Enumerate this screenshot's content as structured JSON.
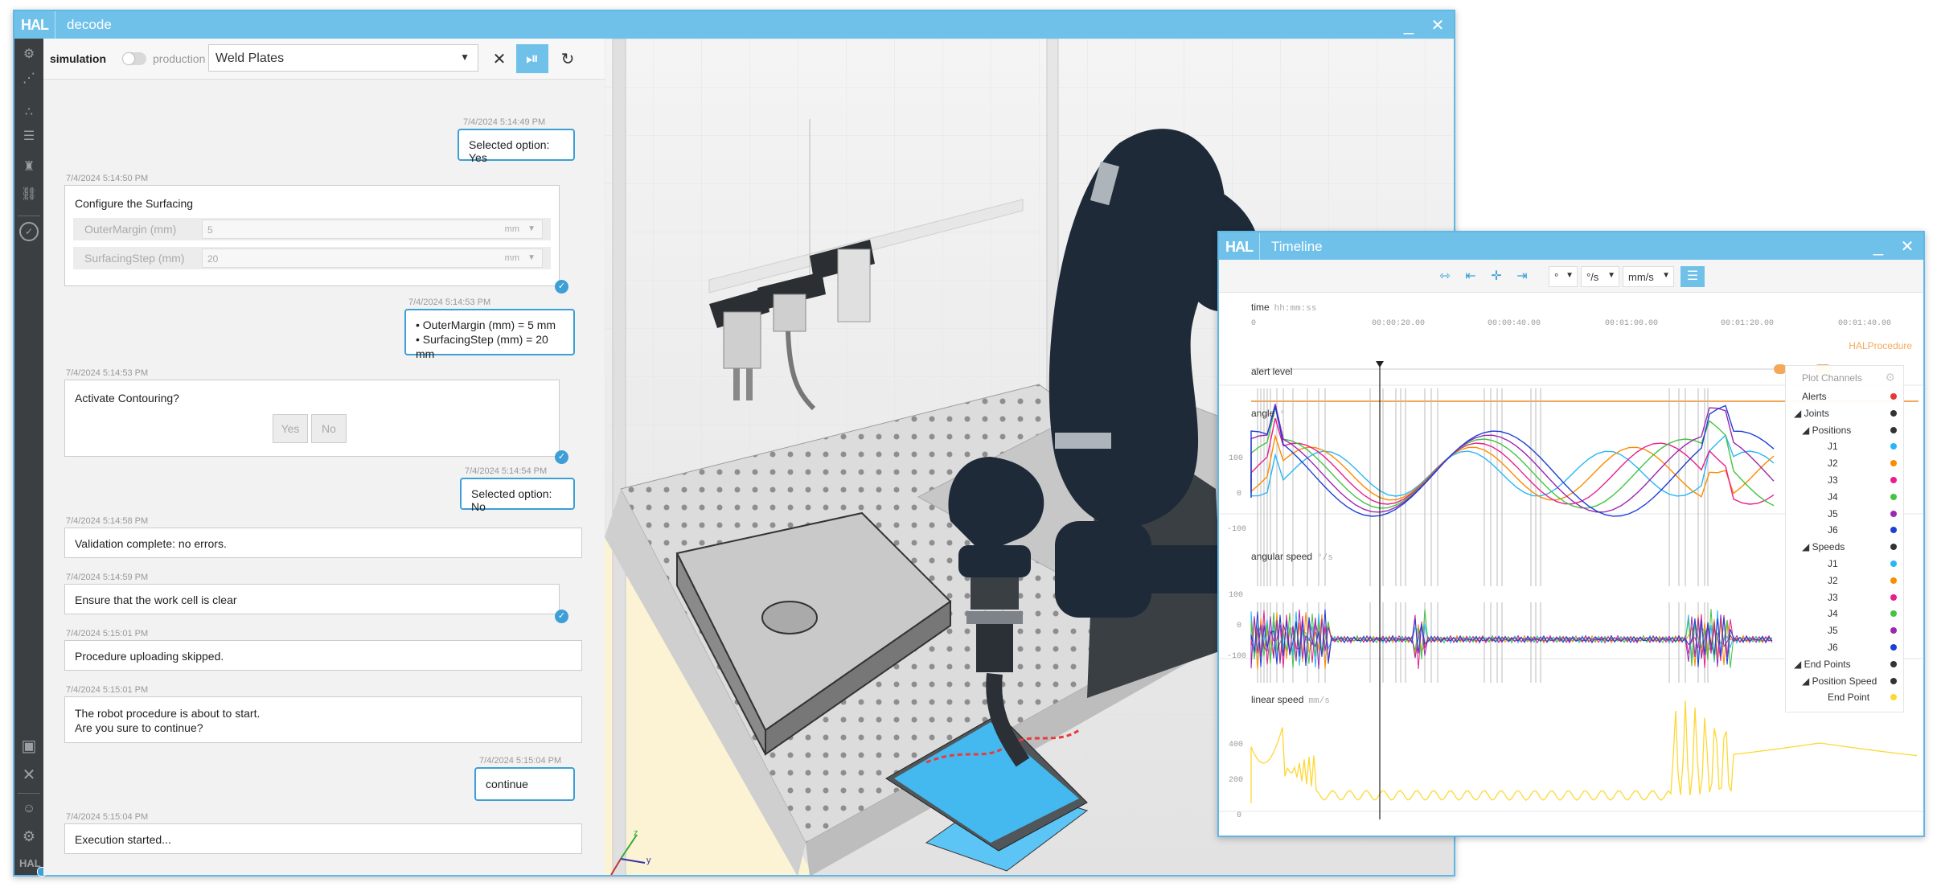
{
  "main_window": {
    "logo": "HAL",
    "title": "decode",
    "minimize": "_",
    "close": "✕"
  },
  "toolbar": {
    "mode_left": "simulation",
    "mode_right": "production",
    "procedure": "Weld Plates"
  },
  "chat": [
    {
      "stamp": "7/4/2024 5:14:49 PM",
      "text": "Selected option: Yes"
    },
    {
      "stamp": "7/4/2024 5:14:50 PM",
      "title": "Configure the Surfacing",
      "fields": [
        {
          "label": "OuterMargin (mm)",
          "value": "5",
          "unit": "mm"
        },
        {
          "label": "SurfacingStep (mm)",
          "value": "20",
          "unit": "mm"
        }
      ]
    },
    {
      "stamp": "7/4/2024 5:14:53 PM",
      "line1": "• OuterMargin (mm) = 5 mm",
      "line2": "• SurfacingStep (mm) = 20 mm"
    },
    {
      "stamp": "7/4/2024 5:14:53 PM",
      "title": "Activate Contouring?",
      "yes": "Yes",
      "no": "No"
    },
    {
      "stamp": "7/4/2024 5:14:54 PM",
      "text": "Selected option: No"
    },
    {
      "stamp": "7/4/2024 5:14:58 PM",
      "text": "Validation complete: no errors."
    },
    {
      "stamp": "7/4/2024 5:14:59 PM",
      "text": "Ensure that the work cell is clear"
    },
    {
      "stamp": "7/4/2024 5:15:01 PM",
      "text": "Procedure uploading skipped."
    },
    {
      "stamp": "7/4/2024 5:15:01 PM",
      "line1": "The robot procedure is about to start.",
      "line2": "Are you sure to continue?"
    },
    {
      "stamp": "7/4/2024 5:15:04 PM",
      "text": "continue"
    },
    {
      "stamp": "7/4/2024 5:15:04 PM",
      "text": "Execution started..."
    }
  ],
  "view": {
    "axis_z": "z",
    "axis_y": "y"
  },
  "timeline": {
    "logo": "HAL",
    "title": "Timeline",
    "minimize": "_",
    "close": "✕",
    "unit_angle": "°",
    "unit_angular": "°/s",
    "unit_linear": "mm/s",
    "time_label": "time",
    "time_format": "hh:mm:ss",
    "ticks": [
      "0",
      "00:00:20.00",
      "00:00:40.00",
      "00:01:00.00",
      "00:01:20.00",
      "00:01:40.00"
    ],
    "track_label": "HALProcedure",
    "channels": [
      {
        "name": "alert level",
        "unit": ""
      },
      {
        "name": "angle",
        "unit": "°"
      },
      {
        "name": "angular speed",
        "unit": "°/s"
      },
      {
        "name": "linear speed",
        "unit": "mm/s"
      }
    ],
    "angle_ticks": [
      "100",
      "0",
      "-100"
    ],
    "angular_ticks": [
      "100",
      "0",
      "-100"
    ],
    "linear_ticks": [
      "400",
      "200",
      "0"
    ],
    "legend": {
      "title": "Plot Channels",
      "items": [
        {
          "label": "Alerts",
          "color": "#e53935"
        },
        {
          "label": "◢ Joints",
          "color": "#333333"
        },
        {
          "label": "◢ Positions",
          "color": "#333333"
        },
        {
          "label": "J1",
          "color": "#29b6f6"
        },
        {
          "label": "J2",
          "color": "#fb8c00"
        },
        {
          "label": "J3",
          "color": "#e91e8c"
        },
        {
          "label": "J4",
          "color": "#43c443"
        },
        {
          "label": "J5",
          "color": "#9c27b0"
        },
        {
          "label": "J6",
          "color": "#1e3fd6"
        },
        {
          "label": "◢ Speeds",
          "color": "#333333"
        },
        {
          "label": "J1",
          "color": "#29b6f6"
        },
        {
          "label": "J2",
          "color": "#fb8c00"
        },
        {
          "label": "J3",
          "color": "#e91e8c"
        },
        {
          "label": "J4",
          "color": "#43c443"
        },
        {
          "label": "J5",
          "color": "#9c27b0"
        },
        {
          "label": "J6",
          "color": "#1e3fd6"
        },
        {
          "label": "◢ End Points",
          "color": "#333333"
        },
        {
          "label": "◢ Position Speed",
          "color": "#333333"
        },
        {
          "label": "End Point",
          "color": "#fdd835"
        }
      ]
    }
  },
  "colors": {
    "accent": "#6fc1ea",
    "selected": "#3d9fd6",
    "iconbar": "#3c3f42"
  }
}
